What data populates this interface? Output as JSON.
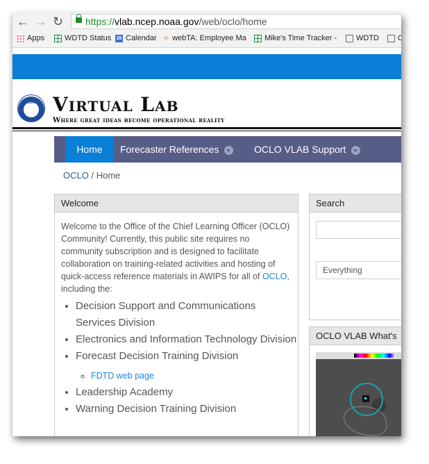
{
  "browser": {
    "url_secure_part": "https://",
    "url_host": "vlab.ncep.noaa.gov",
    "url_path": "/web/oclo/home",
    "bookmarks": [
      {
        "label": "Apps",
        "icon": "apps-grid-icon"
      },
      {
        "label": "WDTD Status",
        "icon": "sheet-icon"
      },
      {
        "label": "Calendar",
        "icon": "calendar-icon",
        "badge": "26"
      },
      {
        "label": "webTA: Employee Ma",
        "icon": "dots-icon"
      },
      {
        "label": "Mike's Time Tracker -",
        "icon": "sheet-icon"
      },
      {
        "label": "WDTD",
        "icon": "document-icon"
      },
      {
        "label": "O",
        "icon": "document-icon"
      }
    ]
  },
  "site": {
    "logo_text": "NOAA",
    "title": "Virtual Lab",
    "tagline": "Where great ideas become operational reality"
  },
  "nav": {
    "home": "Home",
    "forecaster": "Forecaster References",
    "support": "OCLO VLAB Support"
  },
  "breadcrumb": {
    "root": "OCLO",
    "sep": "/",
    "current": "Home"
  },
  "welcome": {
    "heading": "Welcome",
    "intro": "Welcome to the Office of the Chief Learning Officer (OCLO) Community! Currently, this public site requires no community subscription and is designed to facilitate collaboration on training-related activities and hosting of quick-access reference materials in AWIPS for all of ",
    "intro_link": "OCLO",
    "intro_end": ", including the:",
    "items": [
      "Decision Support and Communications Services Division",
      "Electronics and Information Technology Division",
      "Forecast Decision Training Division",
      "Leadership Academy",
      "Warning Decision Training Division"
    ],
    "sub_link": "FDTD web page"
  },
  "search": {
    "heading": "Search",
    "select_value": "Everything"
  },
  "whatsnew": {
    "heading": "OCLO VLAB What's"
  }
}
